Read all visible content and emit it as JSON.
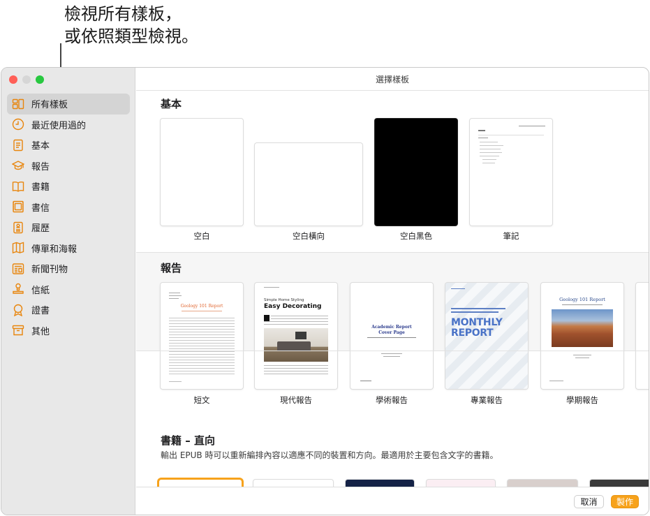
{
  "callout": {
    "line1": "檢視所有樣板，",
    "line2": "或依照類型檢視。"
  },
  "window": {
    "title": "選擇樣板"
  },
  "sidebar": {
    "items": [
      {
        "label": "所有樣板",
        "icon": "grid-icon",
        "active": true
      },
      {
        "label": "最近使用過的",
        "icon": "clock-icon"
      },
      {
        "label": "基本",
        "icon": "document-icon"
      },
      {
        "label": "報告",
        "icon": "graduation-cap-icon"
      },
      {
        "label": "書籍",
        "icon": "book-icon"
      },
      {
        "label": "書信",
        "icon": "letter-icon"
      },
      {
        "label": "履歷",
        "icon": "resume-icon"
      },
      {
        "label": "傳單和海報",
        "icon": "flyer-icon"
      },
      {
        "label": "新聞刊物",
        "icon": "newsletter-icon"
      },
      {
        "label": "信紙",
        "icon": "stamp-icon"
      },
      {
        "label": "證書",
        "icon": "ribbon-icon"
      },
      {
        "label": "其他",
        "icon": "box-icon"
      }
    ]
  },
  "sections": {
    "basic": {
      "title": "基本",
      "templates": [
        "空白",
        "空白橫向",
        "空白黑色",
        "筆記"
      ]
    },
    "reports": {
      "title": "報告",
      "templates": [
        "短文",
        "現代報告",
        "學術報告",
        "專業報告",
        "學期報告"
      ],
      "thumbs": {
        "essay_title": "Geology 101 Report",
        "modern_kicker": "Simple Home Styling",
        "modern_title": "Easy Decorating",
        "academic_title": "Academic Report",
        "academic_sub": "Cover Page",
        "pro_title_1": "MONTHLY",
        "pro_title_2": "REPORT",
        "term_title": "Geology 101 Report"
      }
    },
    "books": {
      "title": "書籍 – 直向",
      "subtitle": "輸出 EPUB 時可以重新編排內容以適應不同的裝置和方向。最適用於主要包含文字的書籍。"
    }
  },
  "footer": {
    "cancel": "取消",
    "create": "製作"
  },
  "colors": {
    "accent": "#f7a21b",
    "sidebar_icon": "#e8850c"
  }
}
